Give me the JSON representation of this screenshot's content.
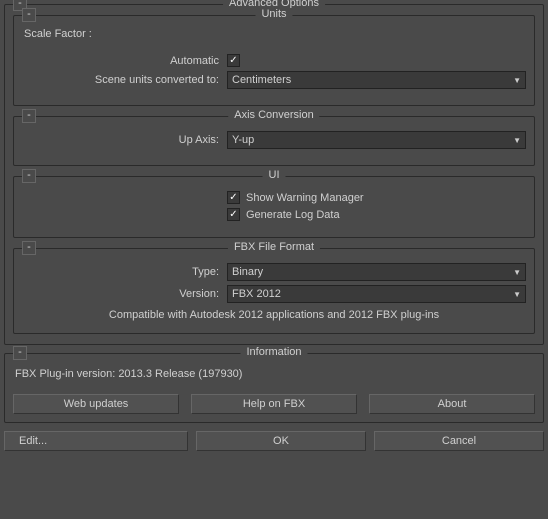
{
  "advanced": {
    "title": "Advanced Options",
    "collapse": "-",
    "units": {
      "title": "Units",
      "collapse": "-",
      "scale_factor_label": "Scale Factor :",
      "automatic_label": "Automatic",
      "automatic_checked": true,
      "converted_label": "Scene units converted to:",
      "converted_value": "Centimeters"
    },
    "axis": {
      "title": "Axis Conversion",
      "collapse": "-",
      "up_axis_label": "Up Axis:",
      "up_axis_value": "Y-up"
    },
    "ui": {
      "title": "UI",
      "collapse": "-",
      "warning_label": "Show Warning Manager",
      "warning_checked": true,
      "log_label": "Generate Log Data",
      "log_checked": true
    },
    "fbx": {
      "title": "FBX File Format",
      "collapse": "-",
      "type_label": "Type:",
      "type_value": "Binary",
      "version_label": "Version:",
      "version_value": "FBX 2012",
      "note": "Compatible with Autodesk 2012 applications and 2012 FBX plug-ins"
    }
  },
  "information": {
    "title": "Information",
    "collapse": "-",
    "plugin_version": "FBX Plug-in version: 2013.3 Release (197930)",
    "web_updates": "Web updates",
    "help": "Help on FBX",
    "about": "About"
  },
  "buttons": {
    "edit": "Edit...",
    "ok": "OK",
    "cancel": "Cancel"
  }
}
